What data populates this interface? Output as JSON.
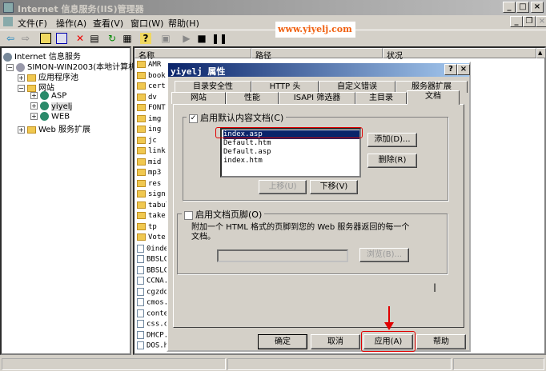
{
  "window": {
    "title": "Internet 信息服务(IIS)管理器",
    "min": "_",
    "max": "□",
    "close": "×"
  },
  "menu": [
    "文件(F)",
    "操作(A)",
    "查看(V)",
    "窗口(W)",
    "帮助(H)"
  ],
  "watermark": "www.yiyelj.com",
  "tree": {
    "root": "Internet 信息服务",
    "server": "SIMON-WIN2003(本地计算机)",
    "app_pools": "应用程序池",
    "websites": "网站",
    "sites": [
      "ASP",
      "yiyelj",
      "WEB"
    ],
    "web_ext": "Web 服务扩展"
  },
  "list": {
    "columns": [
      "名称",
      "路径",
      "状况"
    ],
    "folders": [
      "AMR",
      "book",
      "cert",
      "dv",
      "FONT",
      "img",
      "ing",
      "jc",
      "link-",
      "mid",
      "mp3",
      "res",
      "sign",
      "tabul",
      "take",
      "tp",
      "Vote"
    ],
    "files": [
      "0inde",
      "BBSLC",
      "BBSLC",
      "CCNA.",
      "cgzdq",
      "cmos.",
      "conte",
      "css.c",
      "DHCP.",
      "DOS.h"
    ]
  },
  "dialog": {
    "title": "yiyelj 属性",
    "help": "?",
    "close": "×",
    "tabs_row1": [
      "目录安全性",
      "HTTP 头",
      "自定义错误",
      "服务器扩展"
    ],
    "tabs_row2": [
      "网站",
      "性能",
      "ISAPI 筛选器",
      "主目录",
      "文档"
    ],
    "default_doc": {
      "label": "启用默认内容文档(C)",
      "checked": true,
      "items": [
        "index.asp",
        "Default.htm",
        "Default.asp",
        "index.htm"
      ],
      "selected": 0,
      "add": "添加(D)...",
      "remove": "删除(R)",
      "up": "上移(U)",
      "down": "下移(V)"
    },
    "footer": {
      "label": "启用文档页脚(O)",
      "checked": false,
      "desc": "附加一个 HTML 格式的页脚到您的 Web 服务器返回的每一个文档。",
      "input": "",
      "browse": "浏览(B)..."
    },
    "buttons": {
      "ok": "确定",
      "cancel": "取消",
      "apply": "应用(A)",
      "help": "帮助"
    }
  },
  "highlight_color": "#e00000"
}
